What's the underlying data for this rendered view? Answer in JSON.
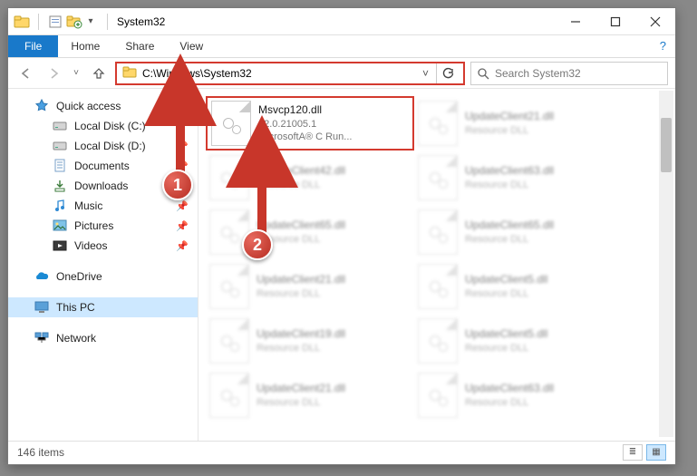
{
  "window": {
    "title": "System32"
  },
  "tabs": {
    "file": "File",
    "home": "Home",
    "share": "Share",
    "view": "View"
  },
  "address": {
    "path": "C:\\Windows\\System32"
  },
  "search": {
    "placeholder": "Search System32"
  },
  "nav": {
    "quick_access": "Quick access",
    "items": [
      {
        "label": "Local Disk (C:)",
        "pinned": true
      },
      {
        "label": "Local Disk (D:)",
        "pinned": true
      },
      {
        "label": "Documents",
        "pinned": true
      },
      {
        "label": "Downloads",
        "pinned": true
      },
      {
        "label": "Music",
        "pinned": true
      },
      {
        "label": "Pictures",
        "pinned": true
      },
      {
        "label": "Videos",
        "pinned": true
      }
    ],
    "onedrive": "OneDrive",
    "this_pc": "This PC",
    "network": "Network"
  },
  "highlighted_file": {
    "name": "Msvcp120.dll",
    "version": "12.0.21005.1",
    "desc": "MicrosoftA® C Run..."
  },
  "blurred_files": [
    "UpdateClient21.dll",
    "UpdateClient42.dll",
    "UpdateClient63.dll",
    "UpdateClient65.dll",
    "UpdateClient65.dll",
    "UpdateClient21.dll",
    "UpdateClient5.dll",
    "UpdateClient19.dll",
    "UpdateClient5.dll",
    "UpdateClient21.dll",
    "UpdateClient63.dll"
  ],
  "blurred_desc": "Resource DLL",
  "status": {
    "count": "146 items"
  },
  "annotations": {
    "b1": "1",
    "b2": "2"
  }
}
